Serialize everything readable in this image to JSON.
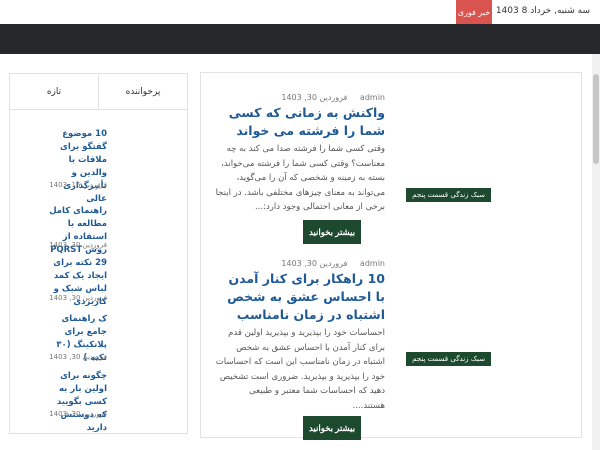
{
  "topbar": {
    "date_text": "سه شنبه, خرداد 8 1403",
    "breaking_label": "خبر فوری"
  },
  "sidebar": {
    "tabs": [
      {
        "label": "پرخواننده"
      },
      {
        "label": "تازه"
      }
    ],
    "items": [
      {
        "title": "10 موضوع گفتگو برای ملاقات با والدین و تأثیرگذاری عالی",
        "date": "فروردین 16, 1403"
      },
      {
        "title": "راهنمای کامل مطالعه با استفاده از روش PQRST",
        "date": "فروردین 30, 1403"
      },
      {
        "title": "29 نکته برای ایجاد یک کمد لباس شیک و کاربردی",
        "date": "فروردین 30, 1403"
      },
      {
        "title": "ک راهنمای جامع برای پلانکینگ (۳۰ نکته )",
        "date": "فروردین 30, 1403"
      },
      {
        "title": "چگونه برای اولین بار به کسی بگویید که دوستش دارید",
        "date": "فروردین 30, 1403"
      }
    ]
  },
  "posts": [
    {
      "date": "فروردین 30, 1403",
      "author": "admin",
      "title": "واکنش به زمانی که کسی شما را فرشته می خواند",
      "excerpt": "وقتی کسی شما را فرشته صدا می کند به چه معناست؟ وقتی کسی شما را فرشته می‌خواند، بسته به زمینه و شخصی که آن را می‌گوید، می‌تواند به معنای چیزهای مختلفی باشد. در اینجا برخی از معانی احتمالی وجود دارد:...",
      "read_more": "بیشتر بخوانید",
      "category": "سبک زندگی قسمت پنجم"
    },
    {
      "date": "فروردین 30, 1403",
      "author": "admin",
      "title": "10 راهکار برای کنار آمدن با احساس عشق به شخص اشتباه در زمان نامناسب",
      "excerpt": "احساسات خود را بپذیرید و بپذیرید اولین قدم برای کنار آمدن با احساس عشق به شخص اشتباه در زمان نامناسب این است که احساسات خود را بپذیرید و بپذیرید. ضروری است تشخیص دهید که احساسات شما معتبر و طبیعی هستند....",
      "read_more": "بیشتر بخوانید",
      "category": "سبک زندگی قسمت پنجم"
    }
  ],
  "colors": {
    "header_band": "#26282b",
    "breaking_bg": "#d9534f",
    "link": "#1f5a96",
    "button": "#1d4a2e"
  }
}
